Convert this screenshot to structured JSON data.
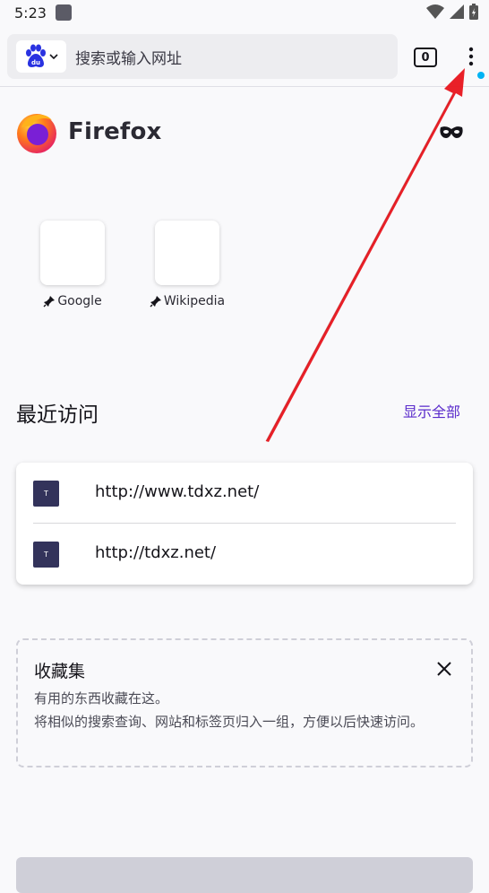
{
  "status": {
    "time": "5:23"
  },
  "toolbar": {
    "search_engine": "baidu",
    "url_placeholder": "搜索或输入网址",
    "tab_count": "0"
  },
  "logo": {
    "text": "Firefox"
  },
  "shortcuts": [
    {
      "label": "Google"
    },
    {
      "label": "Wikipedia"
    }
  ],
  "recent": {
    "title": "最近访问",
    "show_all": "显示全部",
    "items": [
      {
        "favicon": "T",
        "url": "http://www.tdxz.net/"
      },
      {
        "favicon": "T",
        "url": "http://tdxz.net/"
      }
    ]
  },
  "collections": {
    "title": "收藏集",
    "line1": "有用的东西收藏在这。",
    "line2": "将相似的搜索查询、网站和标签页归入一组，方便以后快速访问。"
  },
  "colors": {
    "accent": "#592acb",
    "arrow": "#e8141c",
    "badge": "#00b3f4"
  }
}
